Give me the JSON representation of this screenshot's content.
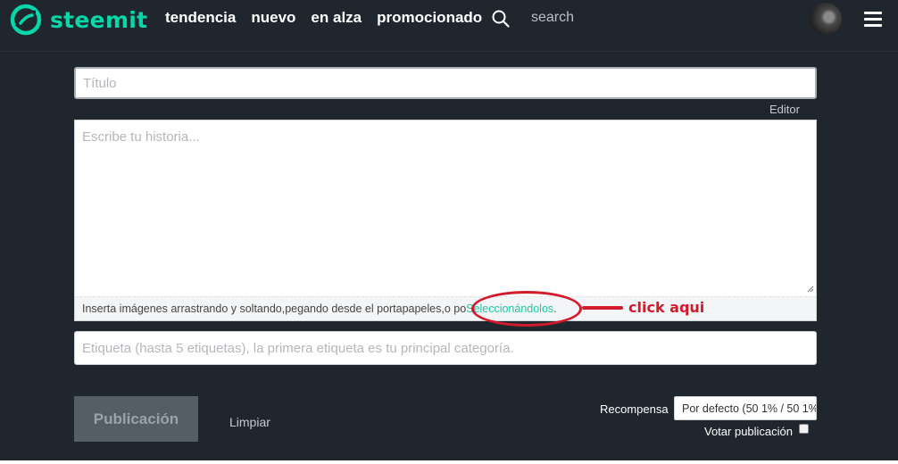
{
  "header": {
    "brand": "steemit",
    "nav": [
      {
        "label": "tendencia"
      },
      {
        "label": "nuevo"
      },
      {
        "label": "en alza"
      },
      {
        "label": "promocionado"
      }
    ],
    "search_placeholder": "search",
    "icons": {
      "logo": "steemit-logo-icon",
      "search": "search-icon",
      "menu": "hamburger-menu-icon"
    },
    "brand_color": "#06d6a9"
  },
  "form": {
    "title_placeholder": "Título",
    "editor_link": "Editor",
    "body_placeholder": "Escribe tu historia...",
    "hint_text": "Inserta imágenes arrastrando y soltando,pegando desde el portapapeles,o po",
    "hint_link": "Seleccionándolos",
    "hint_end": ".",
    "tags_placeholder": "Etiqueta (hasta 5 etiquetas), la primera etiqueta es tu principal categoría."
  },
  "annotation": {
    "text": "click aqui",
    "color": "#d11a2a"
  },
  "actions": {
    "publish_label": "Publicación",
    "clear_label": "Limpiar",
    "reward_label": "Recompensa",
    "reward_value": "Por defecto (50 1% / 50 1%",
    "vote_label": "Votar publicación",
    "vote_checked": false
  }
}
